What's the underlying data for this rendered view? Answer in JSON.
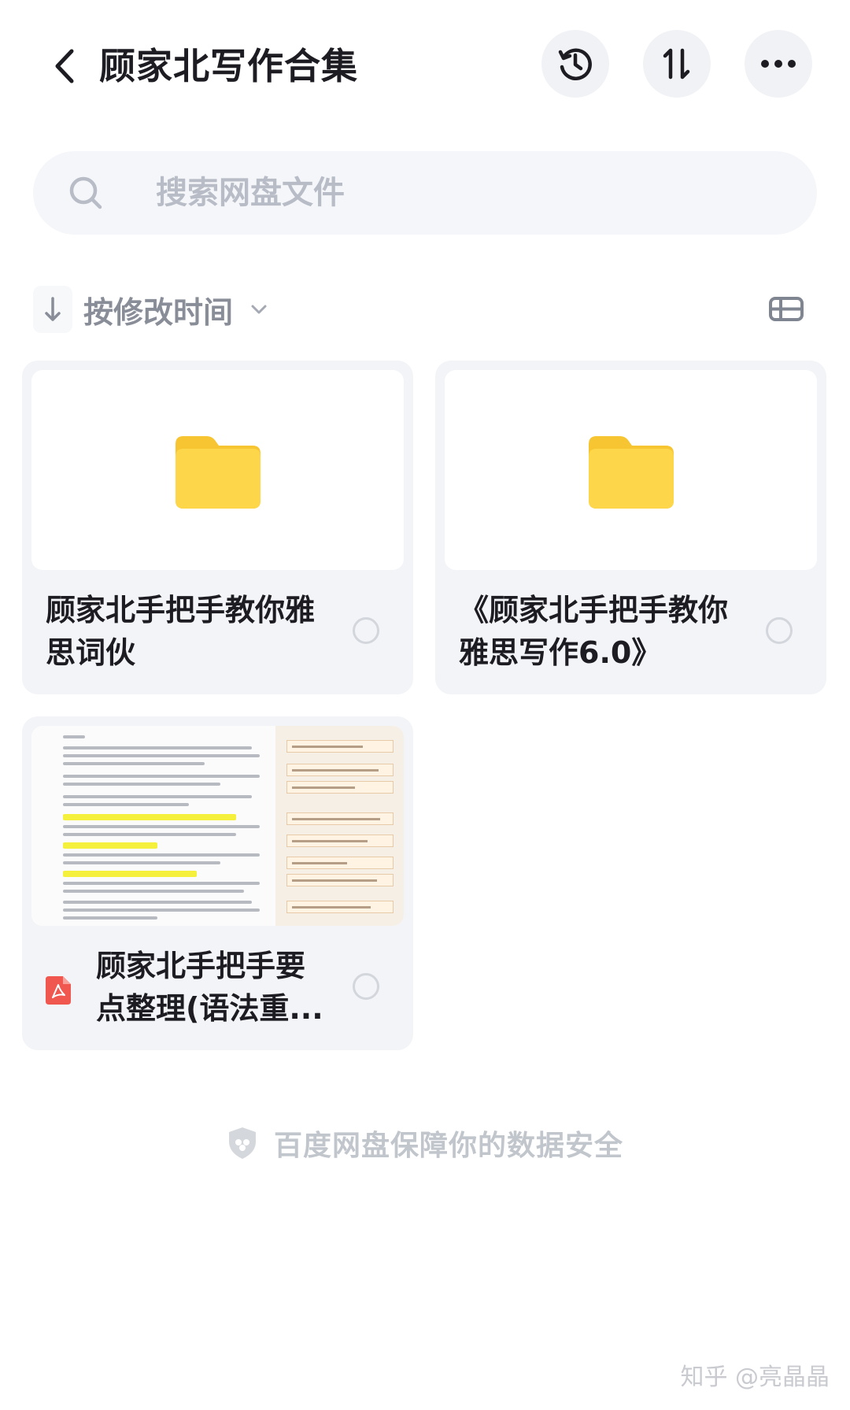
{
  "header": {
    "title": "顾家北写作合集",
    "back_icon": "chevron-left-icon",
    "history_icon": "history-icon",
    "sort_icon": "sort-icon",
    "more_icon": "more-horizontal-icon"
  },
  "search": {
    "placeholder": "搜索网盘文件",
    "value": ""
  },
  "sortbar": {
    "label": "按修改时间",
    "direction_icon": "arrow-down-icon",
    "dropdown_icon": "chevron-down-icon",
    "view_toggle_icon": "list-view-icon"
  },
  "files": [
    {
      "name": "顾家北手把手教你雅思词伙",
      "type": "folder",
      "icon": "folder-icon"
    },
    {
      "name": "《顾家北手把手教你雅思写作6.0》",
      "type": "folder",
      "icon": "folder-icon"
    },
    {
      "name": "顾家北手把手要点整理(语法重...",
      "type": "pdf",
      "icon": "pdf-icon"
    }
  ],
  "footer": {
    "safety_text": "百度网盘保障你的数据安全",
    "safety_icon": "shield-icon"
  },
  "watermark": "知乎 @亮晶晶",
  "colors": {
    "folder": "#FDD64A",
    "card_bg": "#F3F4F7",
    "pdf": "#F0574F"
  }
}
